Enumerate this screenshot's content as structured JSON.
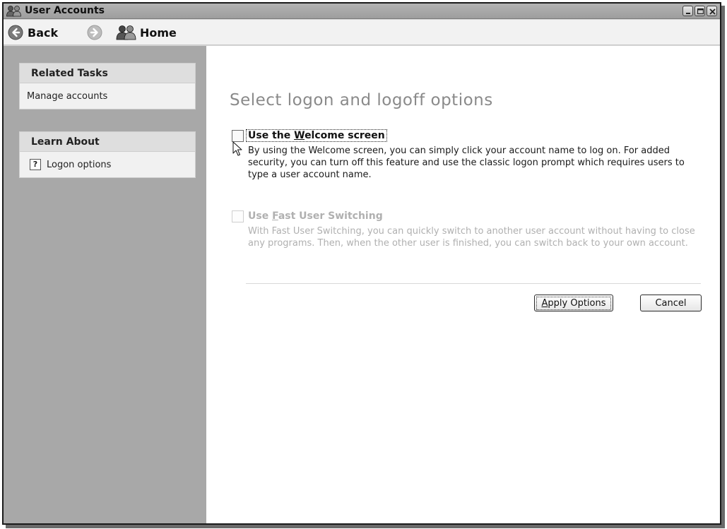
{
  "window": {
    "title": "User Accounts",
    "controls": [
      "minimize-icon",
      "maximize-icon",
      "close-icon"
    ]
  },
  "toolbar": {
    "back_label": "Back",
    "home_label": "Home"
  },
  "sidebar": {
    "related_tasks": {
      "title": "Related Tasks",
      "items": [
        {
          "label": "Manage accounts"
        }
      ]
    },
    "learn_about": {
      "title": "Learn About",
      "items": [
        {
          "label": "Logon options",
          "icon": "help-icon"
        }
      ]
    }
  },
  "main": {
    "heading": "Select logon and logoff options",
    "options": [
      {
        "label_before": "Use the ",
        "label_accel": "W",
        "label_after": "elcome screen",
        "description": "By using the Welcome screen, you can simply click your account name to log on. For added security, you can turn off this feature and use the classic logon prompt which requires users to type a user account name.",
        "checked": false,
        "enabled": true
      },
      {
        "label_before": "Use ",
        "label_accel": "F",
        "label_after": "ast User Switching",
        "description": "With Fast User Switching, you can quickly switch to another user account without having to close any programs. Then, when the other user is finished, you can switch back to your own account.",
        "checked": false,
        "enabled": false
      }
    ],
    "buttons": {
      "apply_accel": "A",
      "apply_rest": "pply Options",
      "cancel": "Cancel"
    }
  },
  "colors": {
    "sidebar_bg": "#a8a8a8",
    "heading": "#8a8a8a",
    "disabled_text": "#b0b0b0"
  }
}
